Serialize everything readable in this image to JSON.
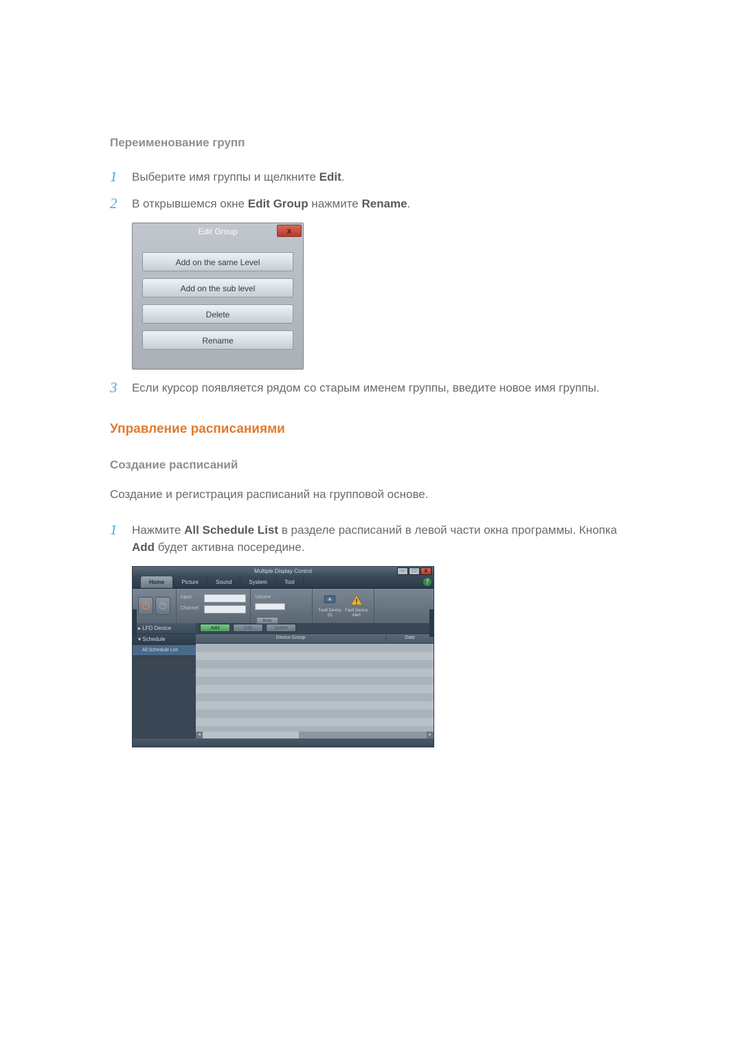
{
  "section1": {
    "title": "Переименование групп",
    "steps": [
      {
        "num": "1",
        "text_a": "Выберите имя группы и щелкните ",
        "bold_a": "Edit",
        "tail": "."
      },
      {
        "num": "2",
        "text_a": "В открывшемся окне ",
        "bold_a": "Edit Group",
        "text_b": " нажмите ",
        "bold_b": "Rename",
        "tail": "."
      },
      {
        "num": "3",
        "text_a": "Если курсор появляется рядом со старым именем группы, введите новое имя группы."
      }
    ],
    "dialog": {
      "title": "Edit Group",
      "close": "x",
      "buttons": [
        "Add on the same Level",
        "Add on the sub level",
        "Delete",
        "Rename"
      ]
    }
  },
  "section2": {
    "heading": "Управление расписаниями",
    "subtitle": "Создание расписаний",
    "desc": "Создание и регистрация расписаний на групповой основе.",
    "steps": [
      {
        "num": "1",
        "text_a": "Нажмите ",
        "bold_a": "All Schedule List",
        "text_b": " в разделе расписаний в левой части окна программы. Кнопка ",
        "bold_b": "Add",
        "tail": " будет активна посередине."
      }
    ]
  },
  "mdc": {
    "title": "Multiple Display Control",
    "help": "?",
    "win": {
      "min": "–",
      "max": "□",
      "close": "x"
    },
    "tabs": [
      "Home",
      "Picture",
      "Sound",
      "System",
      "Tool"
    ],
    "ribbon": {
      "power": {
        "on": "On",
        "off": "Off"
      },
      "input": {
        "label": "Input",
        "channel": "Channel"
      },
      "volume": {
        "label": "Volume",
        "mute": "Mute"
      },
      "fault": {
        "a": "Fault Device",
        "a2": "(0)",
        "b": "Fault Device",
        "b2": "Alert"
      }
    },
    "side": {
      "lfd": "LFD Device",
      "schedule": "Schedule",
      "all": "All Schedule List"
    },
    "actions": {
      "add": "Add",
      "edit": "Edit",
      "del": "Delete"
    },
    "headers": {
      "dg": "Device Group",
      "date": "Date"
    }
  }
}
